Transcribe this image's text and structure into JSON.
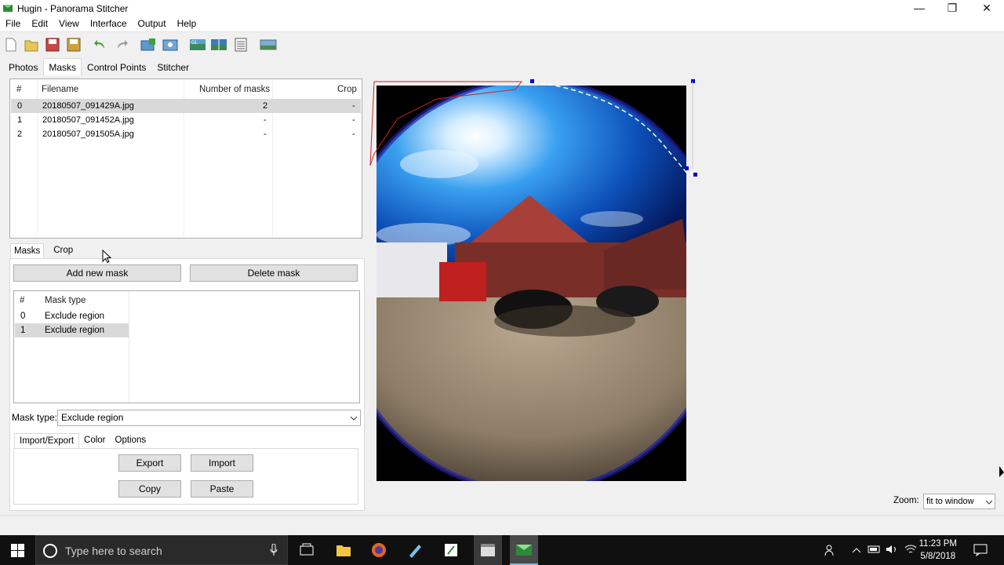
{
  "window": {
    "title": "Hugin - Panorama Stitcher"
  },
  "menu": [
    "File",
    "Edit",
    "View",
    "Interface",
    "Output",
    "Help"
  ],
  "main_tabs": [
    {
      "label": "Photos",
      "active": false
    },
    {
      "label": "Masks",
      "active": true
    },
    {
      "label": "Control Points",
      "active": false
    },
    {
      "label": "Stitcher",
      "active": false
    }
  ],
  "image_table": {
    "headers": {
      "num": "#",
      "filename": "Filename",
      "masks": "Number of masks",
      "crop": "Crop"
    },
    "rows": [
      {
        "num": "0",
        "filename": "20180507_091429A.jpg",
        "masks": "2",
        "crop": "-",
        "selected": true
      },
      {
        "num": "1",
        "filename": "20180507_091452A.jpg",
        "masks": "-",
        "crop": "-",
        "selected": false
      },
      {
        "num": "2",
        "filename": "20180507_091505A.jpg",
        "masks": "-",
        "crop": "-",
        "selected": false
      }
    ]
  },
  "sub_tabs": [
    {
      "label": "Masks",
      "active": true
    },
    {
      "label": "Crop",
      "active": false
    }
  ],
  "buttons": {
    "add_mask": "Add new mask",
    "delete_mask": "Delete mask",
    "export": "Export",
    "import": "Import",
    "copy": "Copy",
    "paste": "Paste"
  },
  "mask_list": {
    "headers": {
      "num": "#",
      "type": "Mask type"
    },
    "rows": [
      {
        "num": "0",
        "type": "Exclude region",
        "selected": false
      },
      {
        "num": "1",
        "type": "Exclude region",
        "selected": true
      }
    ]
  },
  "mask_type": {
    "label": "Mask type:",
    "value": "Exclude region"
  },
  "bottom_tabs": [
    {
      "label": "Import/Export",
      "active": true
    },
    {
      "label": "Color",
      "active": false
    },
    {
      "label": "Options",
      "active": false
    }
  ],
  "zoom": {
    "label": "Zoom:",
    "value": "fit to window"
  },
  "taskbar": {
    "search_placeholder": "Type here to search",
    "time": "11:23 PM",
    "date": "5/8/2018"
  },
  "colors": {
    "mask_outline": "#cc2222",
    "selection_handles": "#0000cc",
    "accent": "#0078d7"
  }
}
